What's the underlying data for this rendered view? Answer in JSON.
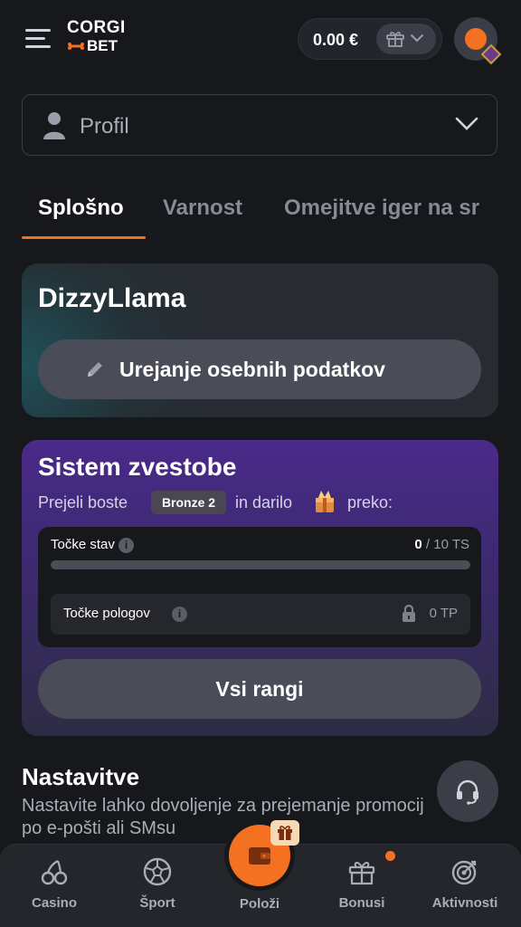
{
  "header": {
    "logo_top": "CORGI",
    "logo_bottom": "BET",
    "balance": "0.00 €"
  },
  "profile_select": {
    "label": "Profil"
  },
  "tabs": [
    {
      "label": "Splošno",
      "active": true
    },
    {
      "label": "Varnost",
      "active": false
    },
    {
      "label": "Omejitve iger na sr",
      "active": false
    }
  ],
  "user_card": {
    "username": "DizzyLlama",
    "edit_button": "Urejanje osebnih podatkov"
  },
  "loyalty": {
    "title": "Sistem zvestobe",
    "text_before": "Prejeli boste",
    "rank": "Bronze 2",
    "text_middle": "in darilo",
    "text_after": "preko:",
    "bet_points_label": "Točke stav",
    "bet_points_value": "0",
    "bet_points_total": "/ 10 TS",
    "bet_points_progress": 0,
    "deposit_points_label": "Točke pologov",
    "deposit_points_value": "0 TP",
    "all_ranks_button": "Vsi rangi"
  },
  "settings": {
    "title": "Nastavitve",
    "description": "Nastavite lahko dovoljenje za prejemanje promocij po e-pošti ali SMsu"
  },
  "bottom_nav": {
    "casino": "Casino",
    "sport": "Šport",
    "deposit": "Položi",
    "bonus": "Bonusi",
    "activity": "Aktivnosti"
  },
  "colors": {
    "accent": "#f37120",
    "background": "#17181c",
    "loyalty_purple": "#4a2a8a"
  },
  "icons": [
    "menu-icon",
    "gift-icon",
    "chevron-down-icon",
    "person-icon",
    "pencil-icon",
    "gift-box-icon",
    "info-icon",
    "lock-icon",
    "headset-icon",
    "cherry-icon",
    "soccer-ball-icon",
    "wallet-icon",
    "target-icon"
  ]
}
